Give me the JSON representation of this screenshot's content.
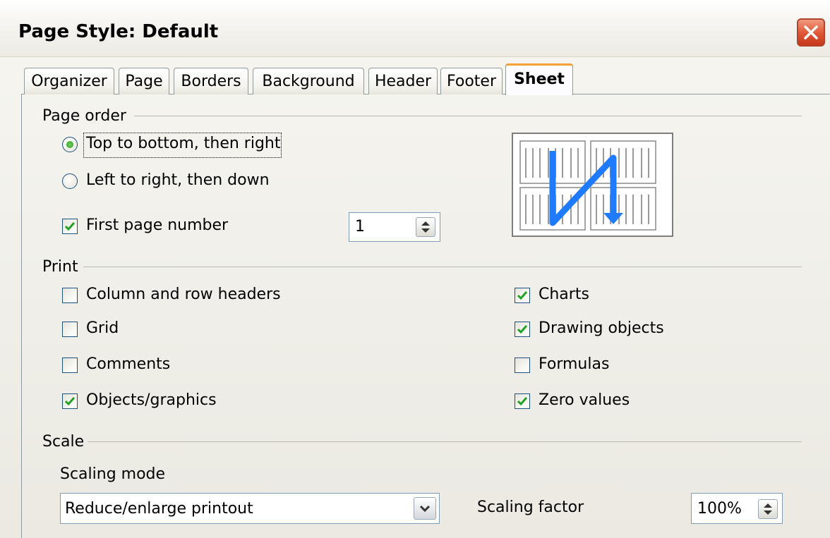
{
  "window": {
    "title": "Page Style: Default"
  },
  "tabs": [
    {
      "label": "Organizer"
    },
    {
      "label": "Page"
    },
    {
      "label": "Borders"
    },
    {
      "label": "Background"
    },
    {
      "label": "Header"
    },
    {
      "label": "Footer"
    },
    {
      "label": "Sheet",
      "active": true
    }
  ],
  "page_order": {
    "label": "Page order",
    "options": [
      {
        "label": "Top to bottom, then right",
        "selected": true,
        "mnemonic": "T"
      },
      {
        "label": "Left to right, then down",
        "selected": false,
        "mnemonic": "L"
      }
    ],
    "first_page_number": {
      "label": "First page number",
      "checked": true,
      "value": "1"
    }
  },
  "print": {
    "label": "Print",
    "left": [
      {
        "label": "Column and row headers",
        "checked": false
      },
      {
        "label": "Grid",
        "checked": false
      },
      {
        "label": "Comments",
        "checked": false
      },
      {
        "label": "Objects/graphics",
        "checked": true
      }
    ],
    "right": [
      {
        "label": "Charts",
        "checked": true
      },
      {
        "label": "Drawing objects",
        "checked": true
      },
      {
        "label": "Formulas",
        "checked": false
      },
      {
        "label": "Zero values",
        "checked": true
      }
    ]
  },
  "scale": {
    "label": "Scale",
    "mode_label": "Scaling mode",
    "mode_value": "Reduce/enlarge printout",
    "factor_label": "Scaling factor",
    "factor_value": "100%"
  },
  "colors": {
    "accent_tab": "#f2a132",
    "arrow_blue": "#1e7bff",
    "close_red": "#e05a38",
    "check_green": "#21a121"
  },
  "icons": {
    "close": "close-icon",
    "check": "check-icon",
    "spin": "spin-arrows-icon",
    "dropdown": "chevron-down-icon",
    "preview": "page-order-preview-icon"
  }
}
